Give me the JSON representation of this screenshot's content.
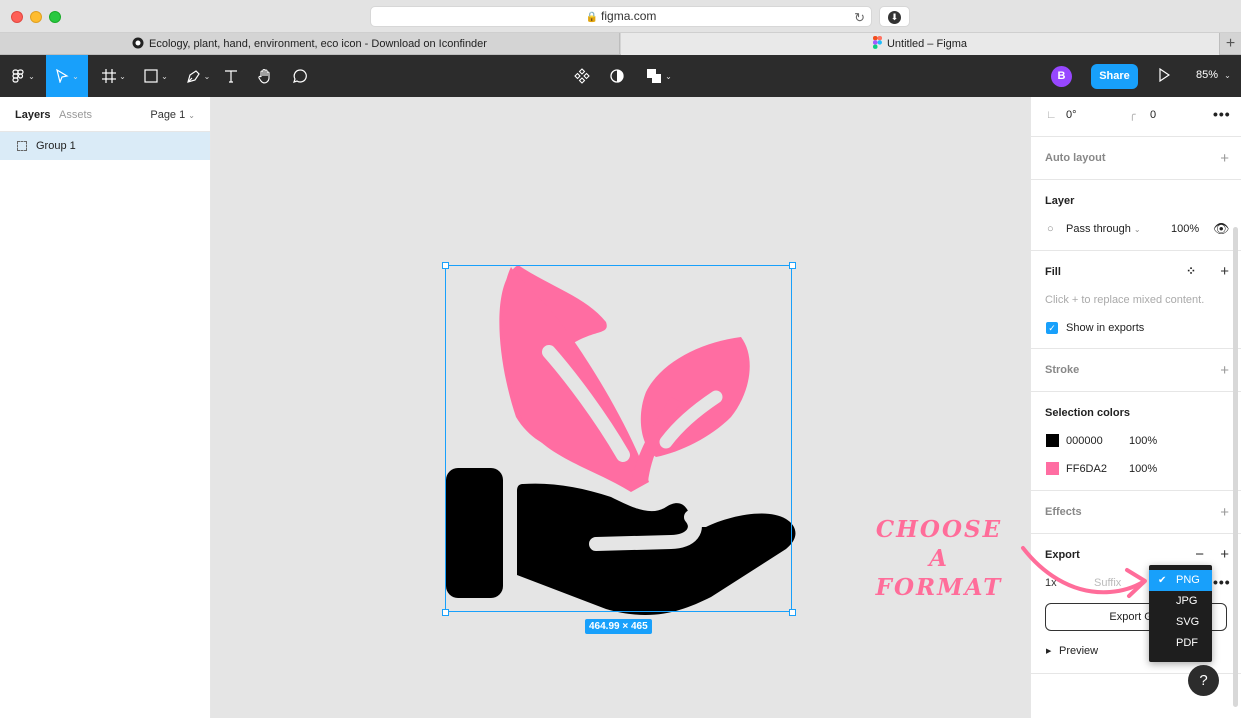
{
  "browser": {
    "url": "figma.com",
    "tabs": [
      {
        "label": "Ecology, plant, hand, environment, eco icon - Download on Iconfinder"
      },
      {
        "label": "Untitled – Figma"
      }
    ]
  },
  "toolbar": {
    "avatar_initial": "B",
    "share_label": "Share",
    "zoom": "85%"
  },
  "left_panel": {
    "tab_layers": "Layers",
    "tab_assets": "Assets",
    "page_label": "Page 1",
    "layers": [
      {
        "name": "Group 1"
      }
    ]
  },
  "canvas": {
    "selection_size": "464.99 × 465"
  },
  "right_panel": {
    "rotation": "0°",
    "corner_radius": "0",
    "auto_layout": "Auto layout",
    "layer": {
      "title": "Layer",
      "blend_mode": "Pass through",
      "opacity": "100%"
    },
    "fill": {
      "title": "Fill",
      "hint": "Click + to replace mixed content.",
      "show_in_exports": "Show in exports"
    },
    "stroke": {
      "title": "Stroke"
    },
    "selection_colors": {
      "title": "Selection colors",
      "colors": [
        {
          "hex": "000000",
          "opacity": "100%",
          "swatch": "#000000"
        },
        {
          "hex": "FF6DA2",
          "opacity": "100%",
          "swatch": "#ff6da2"
        }
      ]
    },
    "effects": {
      "title": "Effects"
    },
    "export": {
      "title": "Export",
      "scale": "1x",
      "suffix_placeholder": "Suffix",
      "button_label": "Export Gro",
      "preview": "Preview",
      "format_options": [
        "PNG",
        "JPG",
        "SVG",
        "PDF"
      ],
      "selected_format": "PNG"
    }
  },
  "annotation": {
    "line1": "Choose a",
    "line2": "format",
    "color": "#ff6d9a"
  },
  "help_label": "?"
}
